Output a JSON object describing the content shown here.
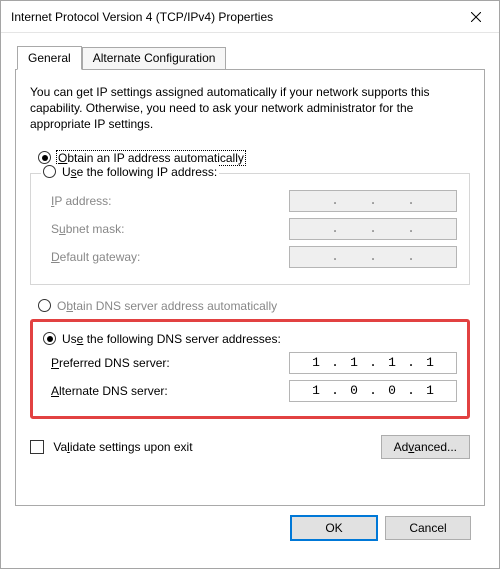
{
  "window": {
    "title": "Internet Protocol Version 4 (TCP/IPv4) Properties"
  },
  "tabs": {
    "general": "General",
    "alternate": "Alternate Configuration"
  },
  "description": "You can get IP settings assigned automatically if your network supports this capability. Otherwise, you need to ask your network administrator for the appropriate IP settings.",
  "ip_section": {
    "auto_prefix": "O",
    "auto_rest": "btain an IP address automatically",
    "manual_prefix": "Use the following IP address:",
    "manual_accel": "S",
    "fields": {
      "ip_prefix": "I",
      "ip_rest": "P address:",
      "mask_prefix": "Subnet mask:",
      "mask_accel": "U",
      "gw_prefix": "D",
      "gw_rest": "efault gateway:"
    }
  },
  "dns_section": {
    "auto_prefix": "Obtain DNS server address automatically",
    "auto_accel": "b",
    "manual_prefix": "Use the following DNS server addresses:",
    "manual_accel": "E",
    "fields": {
      "pref_prefix": "P",
      "pref_rest": "referred DNS server:",
      "alt_prefix": "A",
      "alt_rest": "lternate DNS server:"
    },
    "preferred": {
      "o1": "1",
      "o2": "1",
      "o3": "1",
      "o4": "1"
    },
    "alternate": {
      "o1": "1",
      "o2": "0",
      "o3": "0",
      "o4": "1"
    }
  },
  "validate_prefix": "Validate settings upon exit",
  "validate_accel": "l",
  "buttons": {
    "advanced": "Advanced...",
    "advanced_accel": "v",
    "ok": "OK",
    "cancel": "Cancel"
  }
}
